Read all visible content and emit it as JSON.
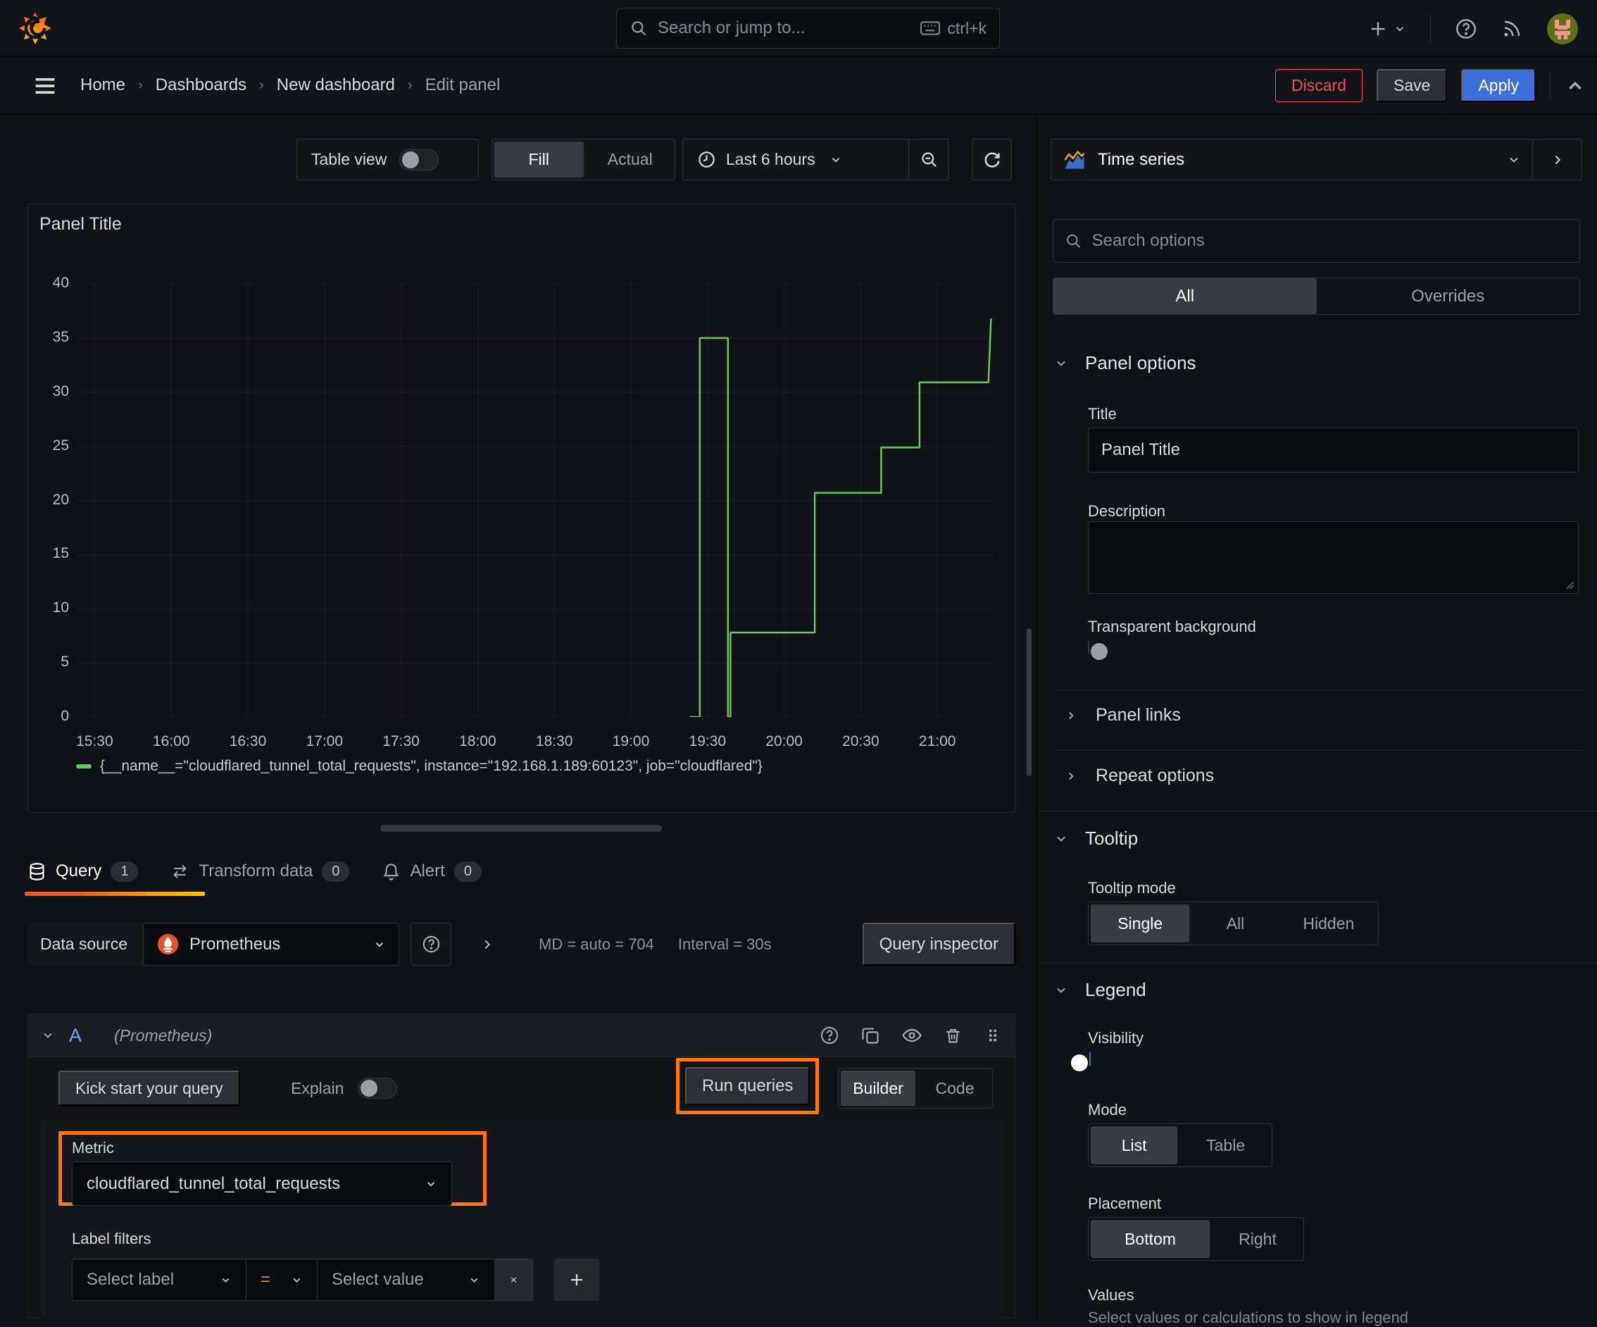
{
  "topbar": {
    "search_placeholder": "Search or jump to...",
    "shortcut": "ctrl+k"
  },
  "breadcrumb": {
    "items": [
      "Home",
      "Dashboards",
      "New dashboard",
      "Edit panel"
    ]
  },
  "actions": {
    "discard": "Discard",
    "save": "Save",
    "apply": "Apply"
  },
  "view_toolbar": {
    "table_view": "Table view",
    "fill": "Fill",
    "actual": "Actual",
    "time_range": "Last 6 hours"
  },
  "panel": {
    "title": "Panel Title"
  },
  "chart_data": {
    "type": "line",
    "line_style": "step-after",
    "color": "#73bf69",
    "title": "Panel Title",
    "xlabel": "",
    "ylabel": "",
    "ylim": [
      0,
      40
    ],
    "y_ticks": [
      0,
      5,
      10,
      15,
      20,
      25,
      30,
      35,
      40
    ],
    "x_ticks": [
      "15:30",
      "16:00",
      "16:30",
      "17:00",
      "17:30",
      "18:00",
      "18:30",
      "19:00",
      "19:30",
      "20:00",
      "20:30",
      "21:00"
    ],
    "x_tick_minutes": [
      0,
      30,
      60,
      90,
      120,
      150,
      180,
      210,
      240,
      270,
      300,
      330
    ],
    "x_range_minutes": [
      -7,
      352
    ],
    "grid": true,
    "legend_position": "bottom",
    "series": [
      {
        "name": "{__name__=\"cloudflared_tunnel_total_requests\", instance=\"192.168.1.189:60123\", job=\"cloudflared\"}",
        "points": [
          [
            233,
            0
          ],
          [
            237,
            0
          ],
          [
            237,
            35
          ],
          [
            248,
            35
          ],
          [
            248,
            0
          ],
          [
            249,
            0
          ],
          [
            249,
            7.8
          ],
          [
            282,
            7.8
          ],
          [
            282,
            20.7
          ],
          [
            308,
            20.7
          ],
          [
            308,
            24.9
          ],
          [
            323,
            24.9
          ],
          [
            323,
            30.9
          ],
          [
            350,
            30.9
          ],
          [
            351,
            36.8
          ]
        ]
      }
    ]
  },
  "query_tabs": {
    "query": "Query",
    "query_count": "1",
    "transform": "Transform data",
    "transform_count": "0",
    "alert": "Alert",
    "alert_count": "0"
  },
  "datasource_row": {
    "label": "Data source",
    "value": "Prometheus",
    "stats_md": "MD = auto = 704",
    "stats_interval": "Interval = 30s",
    "inspector": "Query inspector"
  },
  "query_a": {
    "ref": "A",
    "ds_hint": "(Prometheus)"
  },
  "query_toolbar": {
    "kickstart": "Kick start your query",
    "explain": "Explain",
    "run": "Run queries",
    "builder": "Builder",
    "code": "Code"
  },
  "metric": {
    "label": "Metric",
    "value": "cloudflared_tunnel_total_requests"
  },
  "label_filters": {
    "label": "Label filters",
    "select_label": "Select label",
    "operator": "=",
    "select_value": "Select value"
  },
  "options": {
    "viz": "Time series",
    "search_placeholder": "Search options",
    "tab_all": "All",
    "tab_overrides": "Overrides",
    "panel_options": "Panel options",
    "title_label": "Title",
    "title_value": "Panel Title",
    "description_label": "Description",
    "transparent": "Transparent background",
    "panel_links": "Panel links",
    "repeat_options": "Repeat options",
    "tooltip": "Tooltip",
    "tooltip_mode": "Tooltip mode",
    "tt_single": "Single",
    "tt_all": "All",
    "tt_hidden": "Hidden",
    "legend": "Legend",
    "visibility": "Visibility",
    "mode": "Mode",
    "mode_list": "List",
    "mode_table": "Table",
    "placement": "Placement",
    "pl_bottom": "Bottom",
    "pl_right": "Right",
    "values": "Values",
    "values_hint": "Select values or calculations to show in legend"
  },
  "colors": {
    "accent_orange": "#ff780a",
    "series_green": "#73bf69",
    "accent_blue": "#3d71d9",
    "danger_red": "#f2495c"
  }
}
